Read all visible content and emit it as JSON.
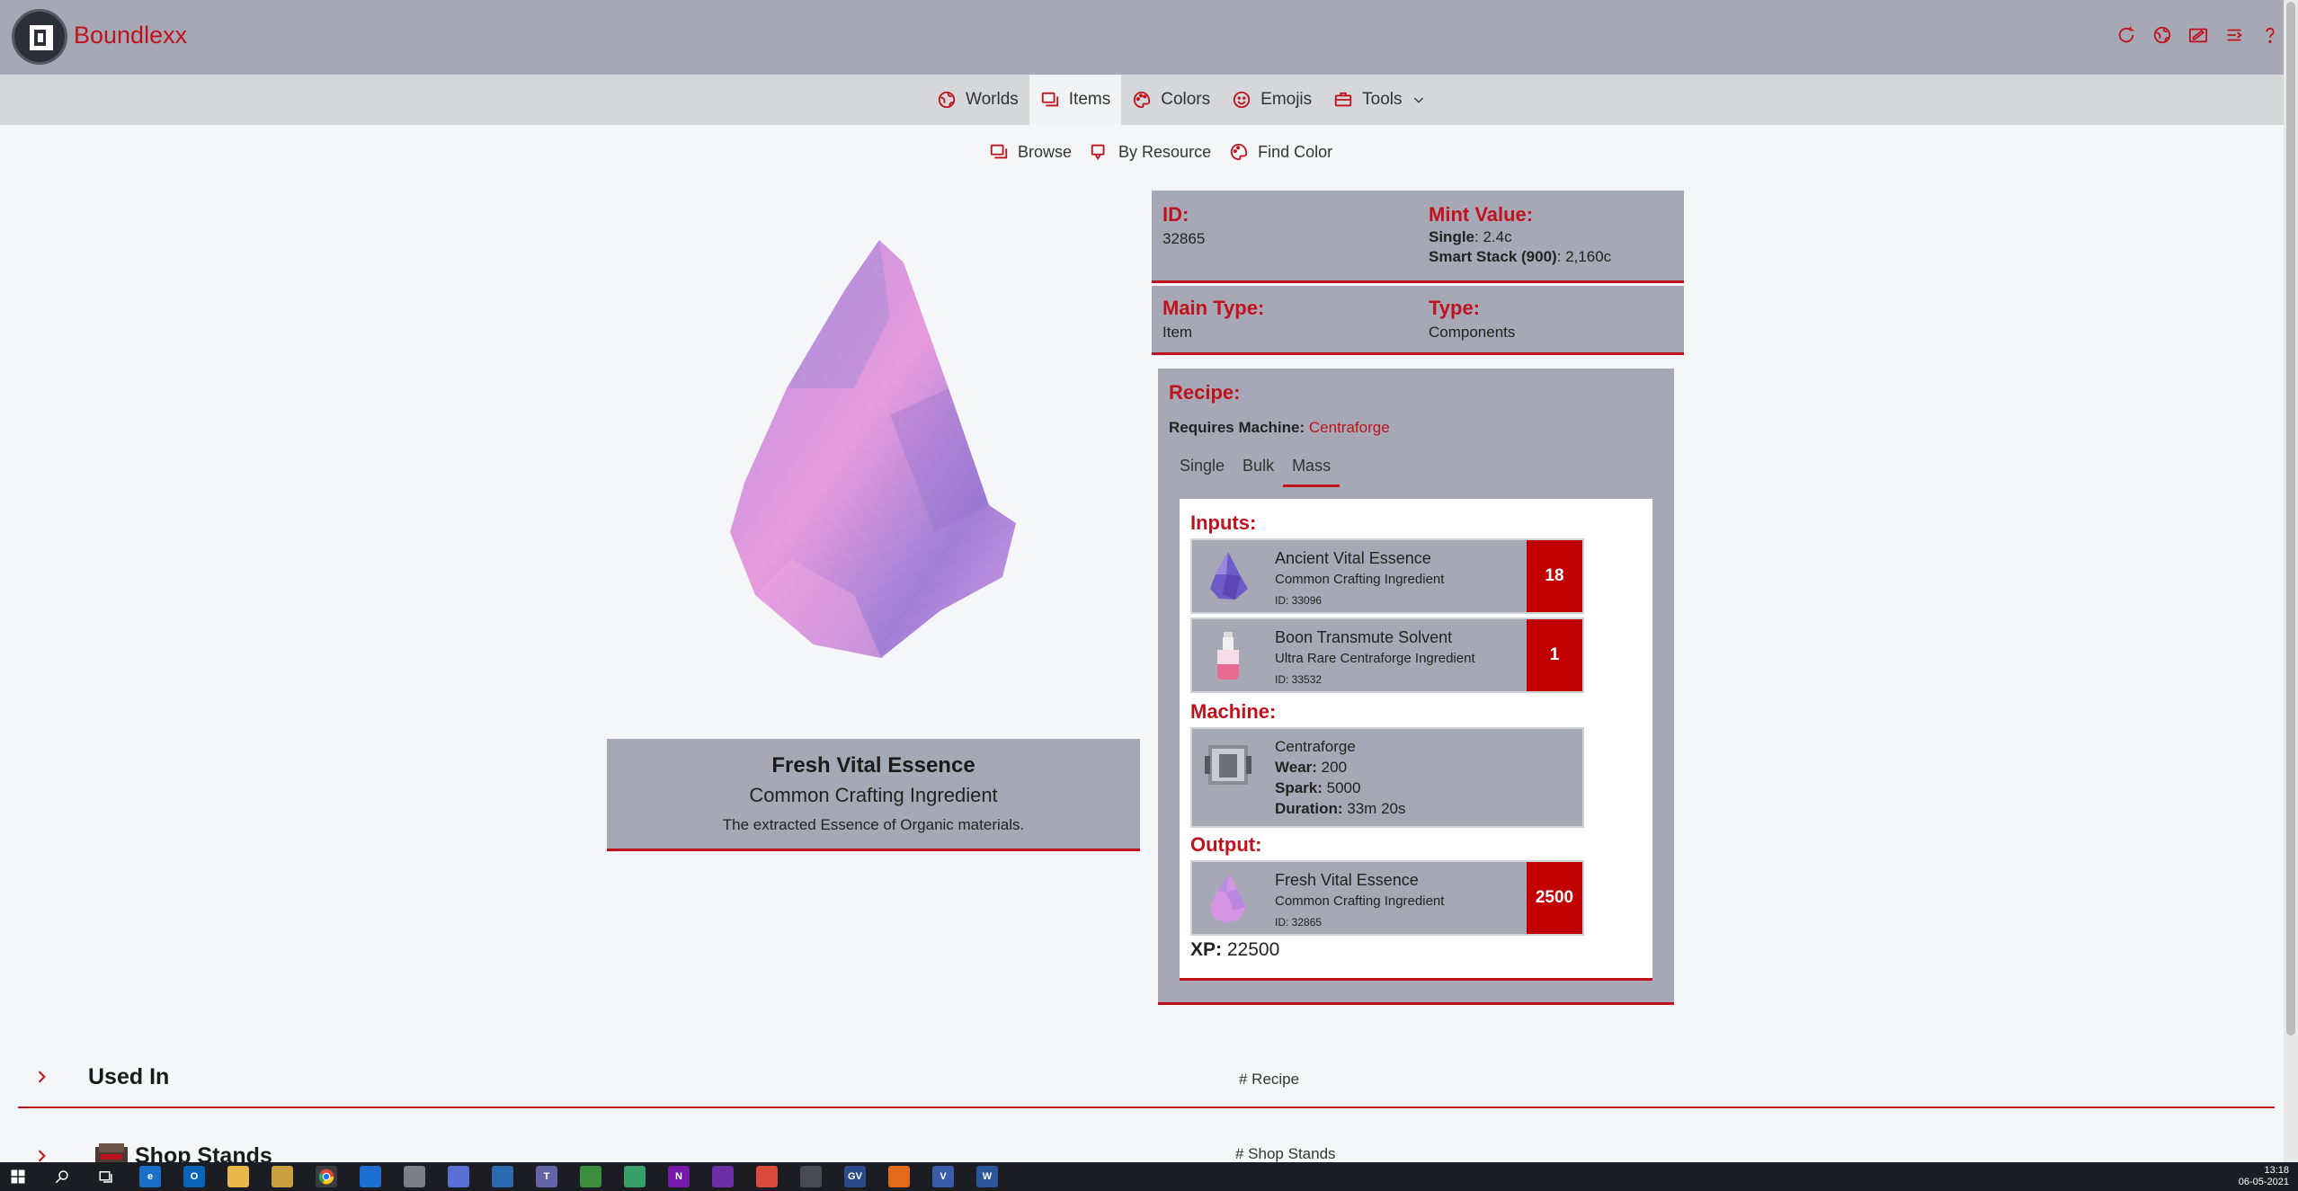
{
  "app": {
    "brand": "Boundlexx"
  },
  "nav": {
    "items": [
      {
        "label": "Worlds",
        "icon": "globe-icon"
      },
      {
        "label": "Items",
        "icon": "items-icon",
        "active": true
      },
      {
        "label": "Colors",
        "icon": "palette-icon"
      },
      {
        "label": "Emojis",
        "icon": "smiley-icon"
      },
      {
        "label": "Tools",
        "icon": "toolbox-icon",
        "dropdown": true
      }
    ]
  },
  "subnav": {
    "items": [
      {
        "label": "Browse",
        "icon": "browse-icon"
      },
      {
        "label": "By Resource",
        "icon": "resource-icon"
      },
      {
        "label": "Find Color",
        "icon": "palette-icon"
      }
    ]
  },
  "item": {
    "name": "Fresh Vital Essence",
    "subtitle": "Common Crafting Ingredient",
    "description": "The extracted Essence of Organic materials."
  },
  "info": {
    "id_label": "ID:",
    "id_value": "32865",
    "mint_label": "Mint Value:",
    "mint_single_label": "Single",
    "mint_single_value": ": 2.4c",
    "mint_stack_label": "Smart Stack (900)",
    "mint_stack_value": ": 2,160c",
    "main_type_label": "Main Type:",
    "main_type_value": "Item",
    "type_label": "Type:",
    "type_value": "Components"
  },
  "recipe": {
    "title": "Recipe:",
    "requires_label": "Requires Machine:",
    "requires_machine": "Centraforge",
    "tabs": [
      "Single",
      "Bulk",
      "Mass"
    ],
    "active_tab": "Mass",
    "inputs_label": "Inputs:",
    "inputs": [
      {
        "name": "Ancient Vital Essence",
        "subtitle": "Common Crafting Ingredient",
        "id": "ID: 33096",
        "qty": "18",
        "icon": "crystal-icon"
      },
      {
        "name": "Boon Transmute Solvent",
        "subtitle": "Ultra Rare Centraforge Ingredient",
        "id": "ID: 33532",
        "qty": "1",
        "icon": "potion-icon"
      }
    ],
    "machine_label": "Machine:",
    "machine": {
      "name": "Centraforge",
      "wear_label": "Wear:",
      "wear_value": " 200",
      "spark_label": "Spark:",
      "spark_value": " 5000",
      "duration_label": "Duration:",
      "duration_value": " 33m 20s"
    },
    "output_label": "Output:",
    "output": {
      "name": "Fresh Vital Essence",
      "subtitle": "Common Crafting Ingredient",
      "id": "ID: 32865",
      "qty": "2500",
      "icon": "crystal-icon"
    },
    "xp_label": "XP:",
    "xp_value": " 22500"
  },
  "sections": {
    "used_in": {
      "title": "Used In",
      "hash": "# Recipe"
    },
    "shop_stands": {
      "title": "Shop Stands",
      "hash": "# Shop Stands"
    }
  },
  "taskbar": {
    "time": "13:18",
    "date": "06-05-2021"
  },
  "colors": {
    "accent": "#c0121d",
    "panel": "#a6a9b5",
    "header": "#a6a9b5",
    "qty": "#c10000"
  }
}
